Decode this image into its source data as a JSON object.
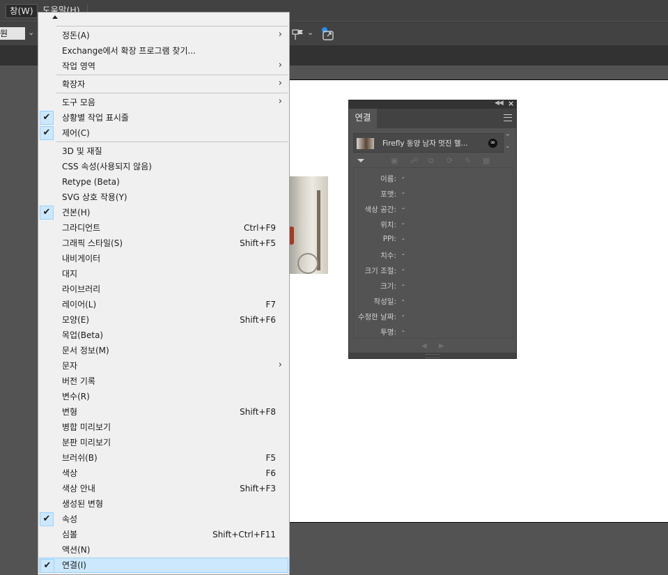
{
  "menubar": {
    "window_menu": "창(W)",
    "help_menu": "도움말(H)"
  },
  "controlbar": {
    "select_value": "원"
  },
  "menu": {
    "items": [
      {
        "label": "정돈(A)",
        "submenu": true
      },
      {
        "label": "Exchange에서 확장 프로그램 찾기..."
      },
      {
        "label": "작업 영역",
        "submenu": true
      },
      {
        "label": "확장자",
        "submenu": true
      },
      {
        "label": "도구 모음",
        "submenu": true
      },
      {
        "label": "상황별 작업 표시줄",
        "checked": true
      },
      {
        "label": "제어(C)",
        "checked": true
      },
      {
        "label": "3D 및 재질"
      },
      {
        "label": "CSS 속성(사용되지 않음)"
      },
      {
        "label": "Retype (Beta)"
      },
      {
        "label": "SVG 상호 작용(Y)"
      },
      {
        "label": "견본(H)",
        "checked": true
      },
      {
        "label": "그라디언트",
        "shortcut": "Ctrl+F9"
      },
      {
        "label": "그래픽 스타일(S)",
        "shortcut": "Shift+F5"
      },
      {
        "label": "내비게이터"
      },
      {
        "label": "대지"
      },
      {
        "label": "라이브러리"
      },
      {
        "label": "레이어(L)",
        "shortcut": "F7"
      },
      {
        "label": "모양(E)",
        "shortcut": "Shift+F6"
      },
      {
        "label": "목업(Beta)"
      },
      {
        "label": "문서 정보(M)"
      },
      {
        "label": "문자",
        "submenu": true
      },
      {
        "label": "버전 기록"
      },
      {
        "label": "변수(R)"
      },
      {
        "label": "변형",
        "shortcut": "Shift+F8"
      },
      {
        "label": "병합 미리보기"
      },
      {
        "label": "분판 미리보기"
      },
      {
        "label": "브러쉬(B)",
        "shortcut": "F5"
      },
      {
        "label": "색상",
        "shortcut": "F6"
      },
      {
        "label": "색상 안내",
        "shortcut": "Shift+F3"
      },
      {
        "label": "생성된 변형"
      },
      {
        "label": "속성",
        "checked": true
      },
      {
        "label": "심볼",
        "shortcut": "Shift+Ctrl+F11"
      },
      {
        "label": "액션(N)"
      },
      {
        "label": "연결(I)",
        "checked": true,
        "highlighted": true
      }
    ]
  },
  "links_panel": {
    "tab_label": "연결",
    "link_name": "Firefly 동양 남자 멋진 헬...",
    "info_rows": [
      {
        "key": "이름:",
        "value": "-"
      },
      {
        "key": "포맷:",
        "value": "-"
      },
      {
        "key": "색상 공간:",
        "value": "-"
      },
      {
        "key": "위치:",
        "value": "-"
      },
      {
        "key": "PPI:",
        "value": "-"
      },
      {
        "key": "치수:",
        "value": "-"
      },
      {
        "key": "크기 조절:",
        "value": "-"
      },
      {
        "key": "크기:",
        "value": "-"
      },
      {
        "key": "작성일:",
        "value": "-"
      },
      {
        "key": "수정한 날짜:",
        "value": "-"
      },
      {
        "key": "투명:",
        "value": "-"
      }
    ]
  }
}
